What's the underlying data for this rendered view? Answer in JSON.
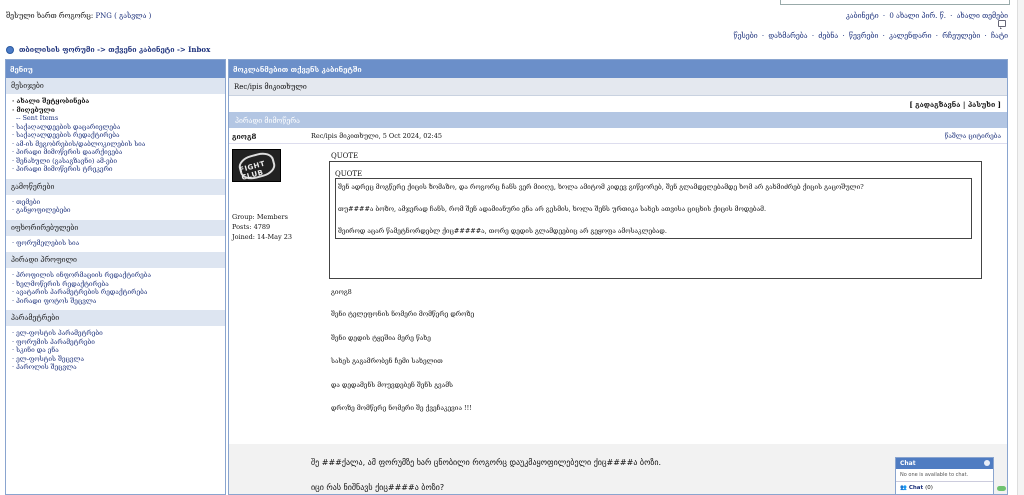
{
  "header": {
    "login_prefix": "შესული ხართ როგორც:",
    "username": "PNG",
    "logout": "( გასვლა )",
    "user_links": [
      "კაბინეტი",
      "·",
      "0 ახალი პირ. წ.",
      "·",
      "ახალი თემები"
    ],
    "nav_links": [
      "წესები",
      "·",
      "დახმარება",
      "·",
      "ძებნა",
      "·",
      "წევრები",
      "·",
      "კალენდარი",
      "·",
      "რჩეულები",
      "·",
      "ჩატი"
    ]
  },
  "breadcrumb": "თბილისის ფორუმი -> თქვენი კაბინეტი -> Inbox",
  "sidebar": {
    "title": "მენიუ",
    "sections": [
      {
        "title": "მესიჯები",
        "items": [
          {
            "label": "· ახალი შეტყობინება",
            "style": "bold"
          },
          {
            "label": "· მიღებული",
            "style": "bold"
          },
          {
            "label": "-- Sent Items",
            "style": "sub"
          },
          {
            "label": "· საქაღალდეების დაცარიელება",
            "style": ""
          },
          {
            "label": "· საქაღალდეების რედაქტირება",
            "style": ""
          },
          {
            "label": "· ამ-ის მეგობრების/დაბლოკილების სია",
            "style": ""
          },
          {
            "label": "· პირადი მიმოწერის დაარქივება",
            "style": ""
          },
          {
            "label": "· შენახული (გასაგზავნი) ამ-ები",
            "style": ""
          },
          {
            "label": "· პირადი მიმოწერის ტრეკერი",
            "style": ""
          }
        ]
      },
      {
        "title": "გამოწერები",
        "items": [
          {
            "label": "· თემები",
            "style": ""
          },
          {
            "label": "· განყოფილებები",
            "style": ""
          }
        ]
      },
      {
        "title": "იფხორირებულები",
        "items": [
          {
            "label": "· ფორუმელების სია",
            "style": ""
          }
        ]
      },
      {
        "title": "პირადი პროფილი",
        "items": [
          {
            "label": "· პროფილის ინფორმაციის რედაქტირება",
            "style": ""
          },
          {
            "label": "· ხელმოწერის რედაქტირება",
            "style": ""
          },
          {
            "label": "· ავატარის პარამეტრების რედაქტირება",
            "style": ""
          },
          {
            "label": "· პირადი ფოტოს შეცვლა",
            "style": ""
          }
        ]
      },
      {
        "title": "პარამეტრები",
        "items": [
          {
            "label": "· ელ-ფოსტის პარამეტრები",
            "style": ""
          },
          {
            "label": "· ფორუმის პარამეტრები",
            "style": ""
          },
          {
            "label": "· სკინი და ენა",
            "style": ""
          },
          {
            "label": "· ელ-ფოსტის შეცვლა",
            "style": ""
          },
          {
            "label": "· პაროლის შეცვლა",
            "style": ""
          }
        ]
      }
    ]
  },
  "main": {
    "title": "მოკლანმებით თქვენს კაბინეტში",
    "recipient_label": "Rec/ipis მიკითხული",
    "actions": "[ გადაგზავნა | პასუხი ]",
    "subheader": "პირადი მიმოწერა",
    "author": "გიოგ8",
    "sent": "Rec/ipis მიკითხული, 5 Oct 2024, 02:45",
    "cite": "წაშლა   ციტირება",
    "author_meta": [
      "Group: Members",
      "Posts: 4789",
      "Joined: 14-May 23"
    ],
    "avatar_text": "FIGHT CLUB",
    "quote_label": "QUOTE",
    "inner_quote_label": "QUOTE",
    "quote_lines": [
      "შენ ადრეც მოგწერე ქიცის ზომაზო, და როგორც ჩანს ვერ მიიღე, ხოლა ამიტომ კიდევ გიწეორებ, შენ გლამდელებამდე ხომ არ გახმიძრებ ქიცის გაცოშული?",
      "თუ####ა ბოზო, ამჯერად ჩანს, რომ შენ ადამიანური ენა არ გესმის, ხოლა შენს ურთიკა სახეს ათვისა ციცხის ქიცის მოდებამ.",
      "შეიროდ აცარ წამეტნორდებლ ქიც#####ა, თორე დედის გლამდეებიც არ გეყოფა ამოსაკლებად."
    ],
    "post_lines": [
      "გიოგ8",
      "შენი ტელეფონის ნომერი მომწერე დროზე",
      "შენი დედის ტყეშია მერე წახე",
      "სახეს გაგამრობენ ჩემი სახელით",
      "და დედამენს მოუვდებენ შენს გვამს",
      "დროზე მომწერე ნომერი შე ქვეჩაკევია !!!"
    ],
    "footer_lines": [
      "შე ###ქალა, ამ ფორუმზე ხარ ცნობილი როგორც დაუკმაყოფილებელი ქიც####ა ბოზი.",
      "იცი რას ნიშნავს ქიც####ა ბოზი?"
    ]
  },
  "chat": {
    "title": "Chat",
    "status": "No one is available to chat.",
    "label": "Chat",
    "count": "(0)"
  }
}
